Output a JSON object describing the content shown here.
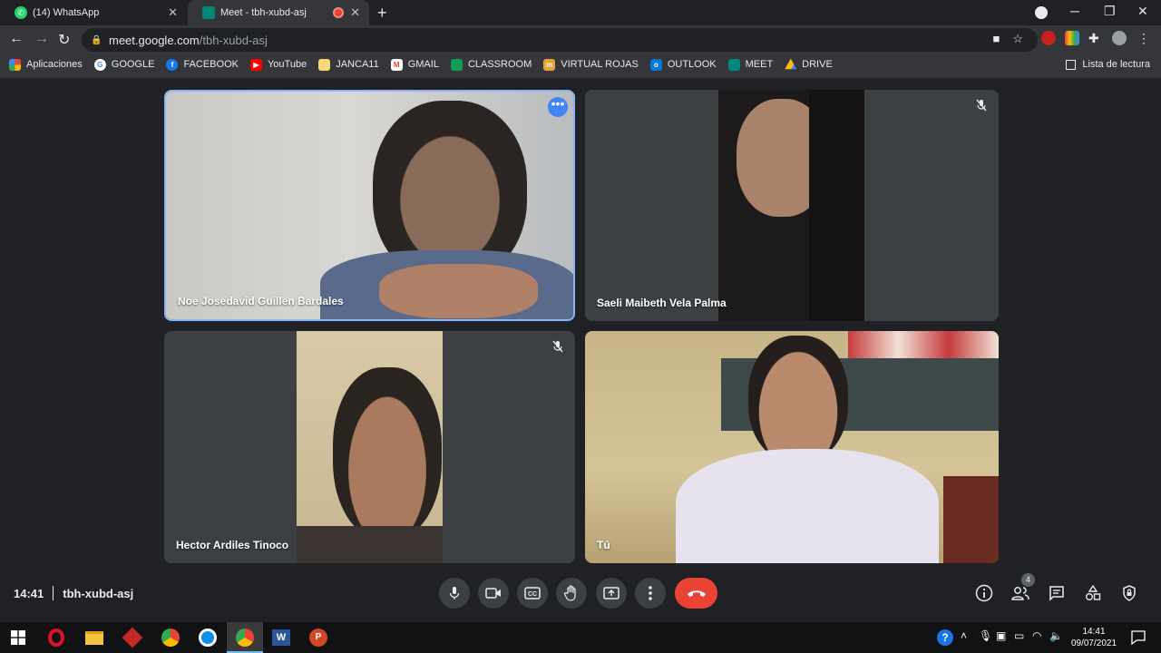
{
  "browser": {
    "tabs": [
      {
        "label": "(14) WhatsApp",
        "icon": "whatsapp-icon"
      },
      {
        "label": "Meet - tbh-xubd-asj",
        "icon": "meet-icon",
        "recording": true
      }
    ],
    "url_host": "meet.google.com",
    "url_path": "/tbh-xubd-asj",
    "bookmarks": [
      {
        "label": "Aplicaciones",
        "icon": "apps-grid-icon",
        "color": "#ea4335"
      },
      {
        "label": "GOOGLE",
        "icon": "google-icon",
        "color": "#ffffff"
      },
      {
        "label": "FACEBOOK",
        "icon": "facebook-icon",
        "color": "#1877f2"
      },
      {
        "label": "YouTube",
        "icon": "youtube-icon",
        "color": "#ff0000"
      },
      {
        "label": "JANCA11",
        "icon": "folder-icon",
        "color": "#f8d775"
      },
      {
        "label": "GMAIL",
        "icon": "gmail-icon",
        "color": "#ea4335"
      },
      {
        "label": "CLASSROOM",
        "icon": "classroom-icon",
        "color": "#0f9d58"
      },
      {
        "label": "VIRTUAL ROJAS",
        "icon": "virtual-rojas-icon",
        "color": "#e8a33b"
      },
      {
        "label": "OUTLOOK",
        "icon": "outlook-icon",
        "color": "#0078d4"
      },
      {
        "label": "MEET",
        "icon": "meet-icon",
        "color": "#00897b"
      },
      {
        "label": "DRIVE",
        "icon": "drive-icon",
        "color": "#fbbc04"
      }
    ],
    "reading_list": "Lista de lectura"
  },
  "participants": [
    {
      "name": "Noe Josedavid Guillen Bardales",
      "muted": false,
      "active": true
    },
    {
      "name": "Saeli Maibeth Vela Palma",
      "muted": true
    },
    {
      "name": "Hector Ardiles Tinoco",
      "muted": true
    },
    {
      "name": "Tú",
      "muted": false
    }
  ],
  "meeting": {
    "time": "14:41",
    "code": "tbh-xubd-asj",
    "participant_count": "4"
  },
  "taskbar": {
    "time": "14:41",
    "date": "09/07/2021"
  },
  "colors": {
    "end_call": "#ea4335",
    "active_border": "#8ab4f8",
    "more_button": "#4285f4"
  }
}
